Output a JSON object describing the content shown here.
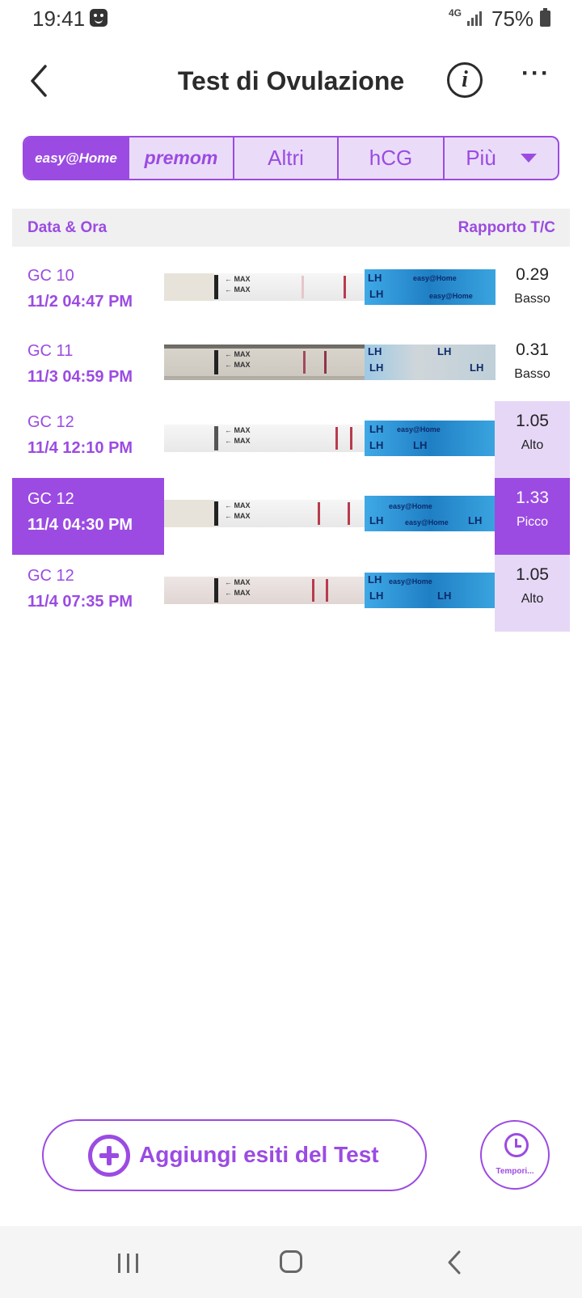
{
  "status_bar": {
    "time": "19:41",
    "network": "4G",
    "battery": "75%"
  },
  "header": {
    "title": "Test di Ovulazione",
    "info_icon": "i"
  },
  "brand_tabs": [
    {
      "label": "easy@Home",
      "active": true
    },
    {
      "label": "premom",
      "active": false
    },
    {
      "label": "Altri",
      "active": false
    },
    {
      "label": "hCG",
      "active": false
    },
    {
      "label": "Più",
      "active": false,
      "dropdown": true
    }
  ],
  "table": {
    "col_date": "Data & Ora",
    "col_ratio": "Rapporto T/C",
    "rows": [
      {
        "cycle_day": "GC 10",
        "datetime": "11/2  04:47 PM",
        "ratio": "0.29",
        "level": "Basso",
        "selected": false
      },
      {
        "cycle_day": "GC 11",
        "datetime": "11/3  04:59 PM",
        "ratio": "0.31",
        "level": "Basso",
        "selected": false
      },
      {
        "cycle_day": "GC 12",
        "datetime": "11/4  12:10 PM",
        "ratio": "1.05",
        "level": "Alto",
        "selected": false
      },
      {
        "cycle_day": "GC 12",
        "datetime": "11/4  04:30 PM",
        "ratio": "1.33",
        "level": "Picco",
        "selected": true
      },
      {
        "cycle_day": "GC 12",
        "datetime": "11/4  07:35 PM",
        "ratio": "1.05",
        "level": "Alto",
        "selected": false
      }
    ]
  },
  "strip_text": {
    "max": "← MAX",
    "lh": "LH",
    "brand": "easy@Home"
  },
  "actions": {
    "add_results": "Aggiungi esiti del Test",
    "timer": "Tempori..."
  },
  "colors": {
    "accent": "#9b4be2",
    "accent_light": "#e6d7f7"
  }
}
